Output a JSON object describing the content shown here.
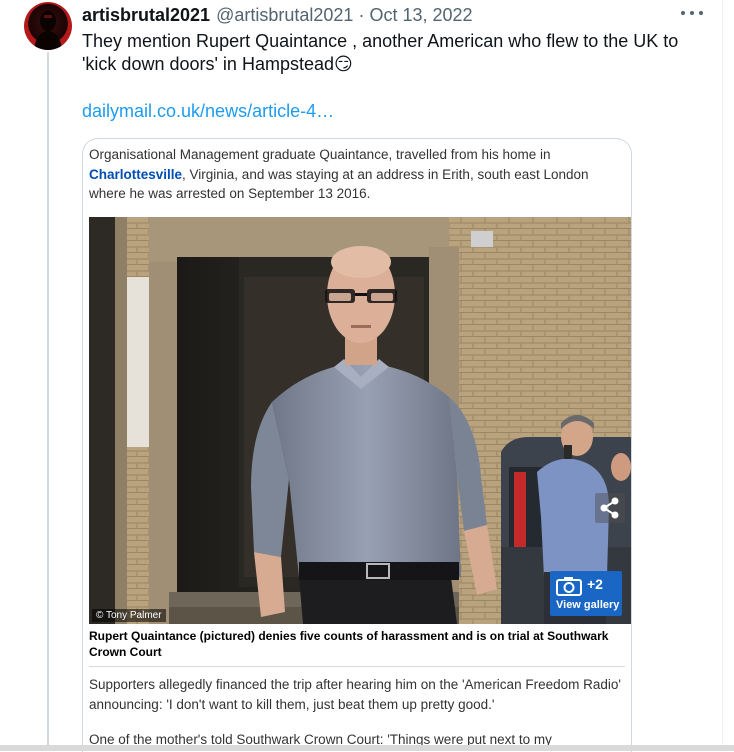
{
  "tweet": {
    "display_name": "artisbrutal2021",
    "handle": "@artisbrutal2021",
    "separator": "·",
    "date": "Oct 13, 2022",
    "text": "They mention Rupert Quaintance , another American who flew to the UK to 'kick down doors' in Hampstead😏",
    "link": "dailymail.co.uk/news/article-4…",
    "more_icon": "more-horizontal-icon"
  },
  "card": {
    "intro_before": "Organisational Management graduate Quaintance, travelled from his home in ",
    "intro_location": "Charlottesville",
    "intro_after": ", Virginia, and was staying at an address in Erith, south east London where he was arrested on September 13 2016.",
    "photo_credit": "© Tony Palmer",
    "gallery_count": "+2",
    "gallery_label": "View gallery",
    "share_icon": "share-icon",
    "camera_icon": "camera-icon",
    "caption": "Rupert Quaintance (pictured) denies five counts of harassment and is on trial at Southwark Crown Court",
    "paragraph_1": "Supporters allegedly financed the trip after hearing him on the 'American Freedom Radio' announcing: 'I don't want to kill them, just beat them up pretty good.'",
    "paragraph_2": "One of the mother's told Southwark Crown Court: 'Things were put next to my"
  },
  "colors": {
    "link": "#1d9bf0",
    "location_link": "#004db3",
    "gallery_button": "#1a66c4",
    "secondary_text": "#536471"
  }
}
